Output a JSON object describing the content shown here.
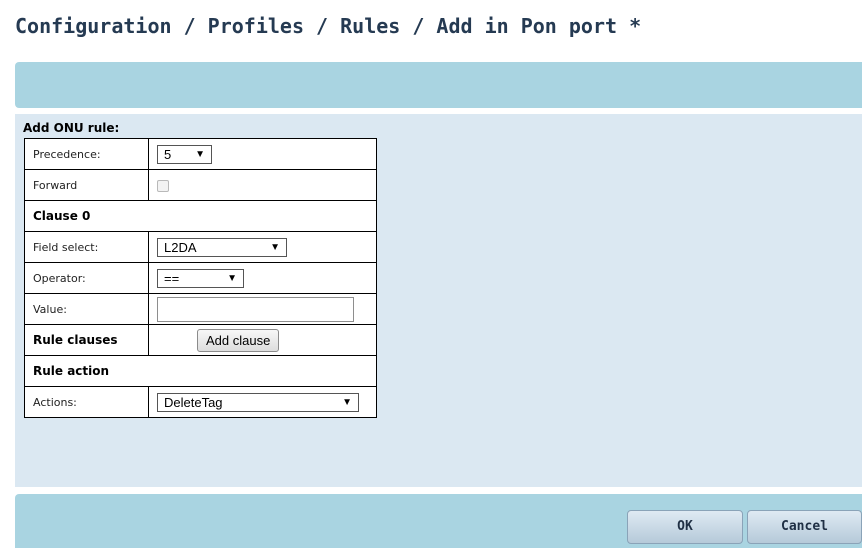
{
  "page": {
    "title": "Configuration / Profiles / Rules / Add in Pon port *"
  },
  "form": {
    "section_label": "Add ONU rule:",
    "precedence": {
      "label": "Precedence:",
      "value": "5"
    },
    "forward": {
      "label": "Forward",
      "checked": false
    },
    "clause_header": "Clause 0",
    "field_select": {
      "label": "Field select:",
      "value": "L2DA"
    },
    "operator": {
      "label": "Operator:",
      "value": "=="
    },
    "value_field": {
      "label": "Value:",
      "value": ""
    },
    "rule_clauses": {
      "label": "Rule clauses",
      "button_label": "Add clause"
    },
    "rule_action_header": "Rule action",
    "actions": {
      "label": "Actions:",
      "value": "DeleteTag"
    }
  },
  "footer": {
    "ok_label": "OK",
    "cancel_label": "Cancel"
  },
  "icons": {
    "dropdown_arrow": "chevron-down-icon"
  },
  "colors": {
    "banner": "#a9d4e1",
    "content_bg": "#dbe8f2",
    "title_text": "#253a52"
  }
}
